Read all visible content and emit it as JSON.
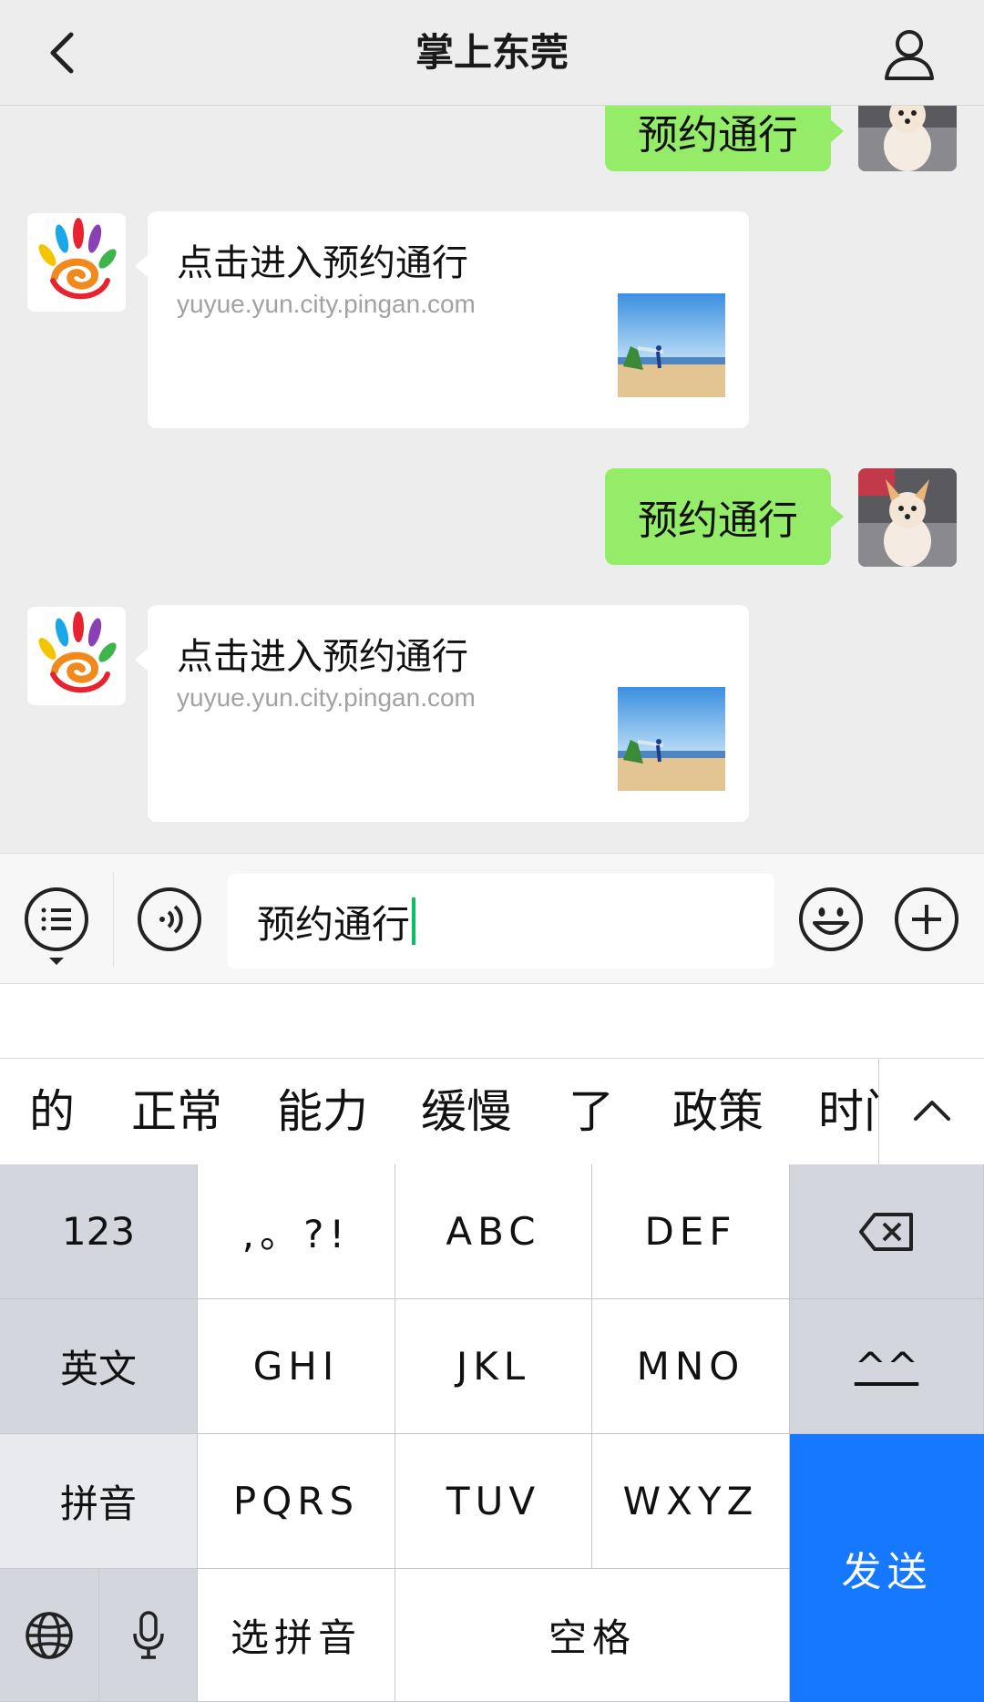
{
  "nav": {
    "title": "掌上东莞",
    "back_icon": "chevron-left-icon",
    "profile_icon": "person-icon"
  },
  "chat": {
    "messages": [
      {
        "from": "me",
        "text": "预约通行"
      },
      {
        "from": "app",
        "title": "点击进入预约通行",
        "url": "yuyue.yun.city.pingan.com"
      },
      {
        "from": "me",
        "text": "预约通行"
      },
      {
        "from": "app",
        "title": "点击进入预约通行",
        "url": "yuyue.yun.city.pingan.com"
      }
    ]
  },
  "input": {
    "value": "预约通行",
    "menu_icon": "list-menu-icon",
    "voice_icon": "voice-icon",
    "emoji_icon": "emoji-icon",
    "plus_icon": "plus-icon"
  },
  "candidates": [
    "的",
    "正常",
    "能力",
    "缓慢",
    "了",
    "政策",
    "时门"
  ],
  "keyboard": {
    "row1": [
      "123",
      ",。?!",
      "ABC",
      "DEF"
    ],
    "row2": [
      "英文",
      "GHI",
      "JKL",
      "MNO",
      "^^"
    ],
    "row3": [
      "拼音",
      "PQRS",
      "TUV",
      "WXYZ"
    ],
    "row4": [
      "选拼音",
      "空格"
    ],
    "send": "发送",
    "backspace_icon": "backspace-icon",
    "globe_icon": "globe-icon",
    "mic_icon": "microphone-icon"
  },
  "colors": {
    "bubble_out": "#95ec69",
    "send_key": "#1677ff",
    "caret": "#07c160"
  }
}
